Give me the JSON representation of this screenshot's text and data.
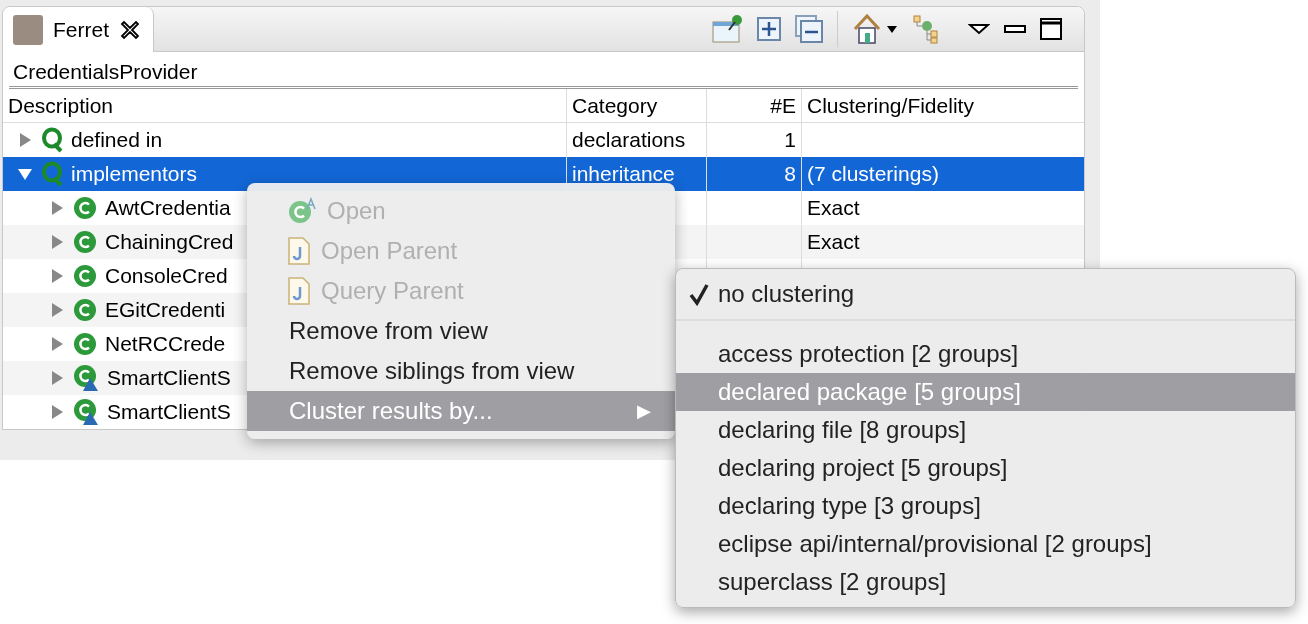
{
  "tab": {
    "title": "Ferret"
  },
  "breadcrumb": "CredentialsProvider",
  "table": {
    "columns": [
      "Description",
      "Category",
      "#E",
      "Clustering/Fidelity"
    ],
    "rows": [
      {
        "kind": "query",
        "expanded": false,
        "selected": false,
        "description": "defined in",
        "category": "declarations",
        "count": "1"
      },
      {
        "kind": "query",
        "expanded": true,
        "selected": true,
        "description": "implementors",
        "category": "inheritance",
        "count": "8",
        "clustering": "(7 clusterings)",
        "children": [
          {
            "kind": "class",
            "expanded": false,
            "selected": false,
            "description": "AwtCredentia",
            "clustering": "Exact"
          },
          {
            "kind": "class",
            "expanded": false,
            "selected": false,
            "description": "ChainingCred",
            "clustering": "Exact"
          },
          {
            "kind": "class",
            "expanded": false,
            "selected": false,
            "description": "ConsoleCred"
          },
          {
            "kind": "class",
            "expanded": false,
            "selected": false,
            "description": "EGitCredenti"
          },
          {
            "kind": "class",
            "expanded": false,
            "selected": false,
            "description": "NetRCCrede"
          },
          {
            "kind": "abstract-class",
            "expanded": false,
            "selected": false,
            "description": "SmartClientS"
          },
          {
            "kind": "abstract-class",
            "expanded": false,
            "selected": false,
            "description": "SmartClientS"
          }
        ]
      }
    ]
  },
  "context_menu": [
    {
      "label": "Open",
      "kind": "class",
      "disabled": true,
      "selected": false
    },
    {
      "label": "Open Parent",
      "kind": "file",
      "disabled": true,
      "selected": false
    },
    {
      "label": "Query Parent",
      "kind": "file",
      "disabled": true,
      "selected": false
    },
    {
      "label": "Remove from view",
      "kind": "plain",
      "disabled": false,
      "selected": false
    },
    {
      "label": "Remove siblings from view",
      "kind": "plain",
      "disabled": false,
      "selected": false
    },
    {
      "label": "Cluster results by...",
      "kind": "plain",
      "disabled": false,
      "selected": true,
      "submenu": "▶"
    }
  ],
  "submenu": [
    {
      "label": "no clustering",
      "checked": true,
      "selected": false,
      "separator_after": true
    },
    {
      "label": "access protection [2 groups]",
      "checked": false,
      "selected": false
    },
    {
      "label": "declared package [5 groups]",
      "checked": false,
      "selected": true
    },
    {
      "label": "declaring file [8 groups]",
      "checked": false,
      "selected": false
    },
    {
      "label": "declaring project [5 groups]",
      "checked": false,
      "selected": false
    },
    {
      "label": "declaring type [3 groups]",
      "checked": false,
      "selected": false
    },
    {
      "label": "eclipse api/internal/provisional [2 groups]",
      "checked": false,
      "selected": false
    },
    {
      "label": "superclass [2 groups]",
      "checked": false,
      "selected": false
    }
  ]
}
